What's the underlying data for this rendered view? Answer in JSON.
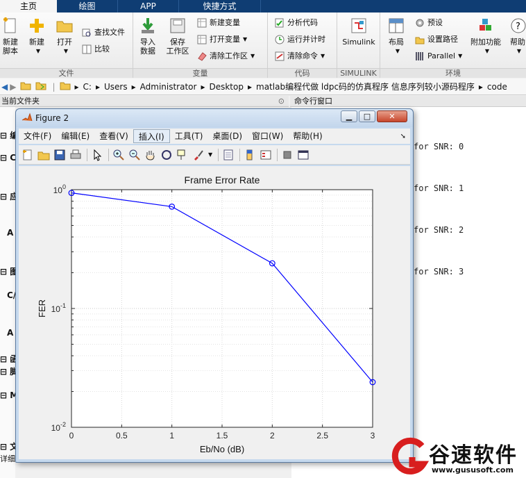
{
  "ribbon_tabs": [
    "主页",
    "绘图",
    "APP",
    "快捷方式"
  ],
  "ribbon": {
    "file_group": {
      "label": "文件",
      "new_script": "新建\n脚本",
      "new": "新建",
      "open": "打开",
      "find_files": "查找文件",
      "compare": "比较"
    },
    "var_group": {
      "label": "变量",
      "import": "导入\n数据",
      "save_ws": "保存\n工作区",
      "new_var": "新建变量",
      "open_var": "打开变量",
      "clear_ws": "清除工作区"
    },
    "code_group": {
      "label": "代码",
      "analyze": "分析代码",
      "run_time": "运行并计时",
      "clear_cmd": "清除命令"
    },
    "simulink_group": {
      "label": "SIMULINK",
      "simulink": "Simulink"
    },
    "env_group": {
      "label": "环境",
      "layout": "布局",
      "prefs": "预设",
      "set_path": "设置路径",
      "parallel": "Parallel",
      "addons": "附加功能",
      "help": "帮助"
    }
  },
  "address": {
    "drive": "C:",
    "path": [
      "Users",
      "Administrator",
      "Desktop",
      "matlab编程代做 ldpc码的仿真程序 信息序列较小源码程序",
      "code"
    ]
  },
  "panels": {
    "current_folder": "当前文件夹",
    "command_window": "命令行窗口",
    "details": "详细"
  },
  "left_rows": [
    "编",
    "C",
    "应",
    "A",
    "图",
    "C/",
    "A",
    "函",
    "脚",
    "M",
    "文"
  ],
  "command_lines": [
    "for SNR: 0",
    "for SNR: 1",
    "for SNR: 2",
    "for SNR: 3"
  ],
  "figure": {
    "title": "Figure 2",
    "menu": [
      "文件(F)",
      "编辑(E)",
      "查看(V)",
      "插入(I)",
      "工具(T)",
      "桌面(D)",
      "窗口(W)",
      "帮助(H)"
    ]
  },
  "chart_data": {
    "type": "line",
    "title": "Frame Error Rate",
    "xlabel": "Eb/No (dB)",
    "ylabel": "FER",
    "xlim": [
      0,
      3
    ],
    "ylim": [
      0.01,
      1
    ],
    "yscale": "log",
    "grid": true,
    "x": [
      0,
      1,
      2,
      3
    ],
    "series": [
      {
        "values": [
          0.94,
          0.72,
          0.24,
          0.024
        ],
        "color": "#0000ff",
        "marker": "circle"
      }
    ],
    "xticks": [
      "0",
      "0.5",
      "1",
      "1.5",
      "2",
      "2.5",
      "3"
    ],
    "yticks": [
      {
        "base": "10",
        "exp": "0"
      },
      {
        "base": "10",
        "exp": "-1"
      },
      {
        "base": "10",
        "exp": "-2"
      }
    ]
  },
  "watermark": {
    "name": "谷速软件",
    "url": "www.gususoft.com"
  },
  "colors": {
    "tab_bar": "#0f3d73",
    "line": "#0000ff"
  }
}
